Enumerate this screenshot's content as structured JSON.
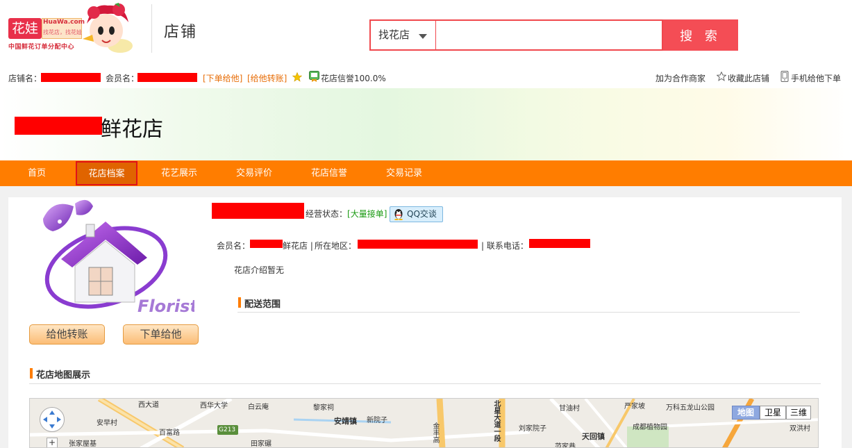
{
  "header": {
    "logo_badge": "花娃",
    "logo_domain": "HuaWa.com",
    "logo_slogan": "找花店，找花娃",
    "logo_sub": "中国鲜花订单分配中心",
    "section_title": "店铺"
  },
  "search": {
    "category": "找花店",
    "query": "",
    "button": "搜 索"
  },
  "infobar": {
    "shop_label": "店铺名：",
    "member_label": "会员名：",
    "order_link": "[下单给他]",
    "transfer_link": "[给他转账]",
    "credit_text": "花店信誉100.0%",
    "right_links": [
      "加为合作商家",
      "收藏此店铺",
      "手机给他下单"
    ]
  },
  "banner": {
    "title_suffix": "鲜花店"
  },
  "nav": {
    "items": [
      "首页",
      "花店档案",
      "花艺展示",
      "交易评价",
      "花店信誉",
      "交易记录"
    ],
    "active": "花店档案"
  },
  "profile": {
    "logo_text": "Florist",
    "transfer_button": "给他转账",
    "order_button": "下单给他",
    "status_label": "经营状态：",
    "status_value": "[大量接单]",
    "qq_button": "QQ交谈",
    "member_label": "会员名：",
    "member_suffix": "鲜花店 |",
    "region_label": "所在地区：",
    "phone_label": "| 联系电话：",
    "intro": "花店介绍暂无",
    "delivery_title": "配送范围"
  },
  "map": {
    "section_title": "花店地图展示",
    "types": [
      "地图",
      "卫星",
      "三维"
    ],
    "active_type": "地图",
    "zoom_in": "+",
    "labels": [
      "西华大学",
      "白云庵",
      "黎家祠",
      "甘油村",
      "严家坡",
      "万科五龙山公园",
      "安靖镇",
      "新院子",
      "刘家院子",
      "成都植物园",
      "双洪村",
      "安早村",
      "百富路",
      "张家屋基",
      "田家碾",
      "天回镇",
      "范家巷",
      "G213",
      "北星大道一段",
      "金丰高",
      "西大道"
    ]
  },
  "colors": {
    "accent_orange": "#ff7d00",
    "search_red": "#f44d55",
    "redaction": "#ff0000"
  }
}
